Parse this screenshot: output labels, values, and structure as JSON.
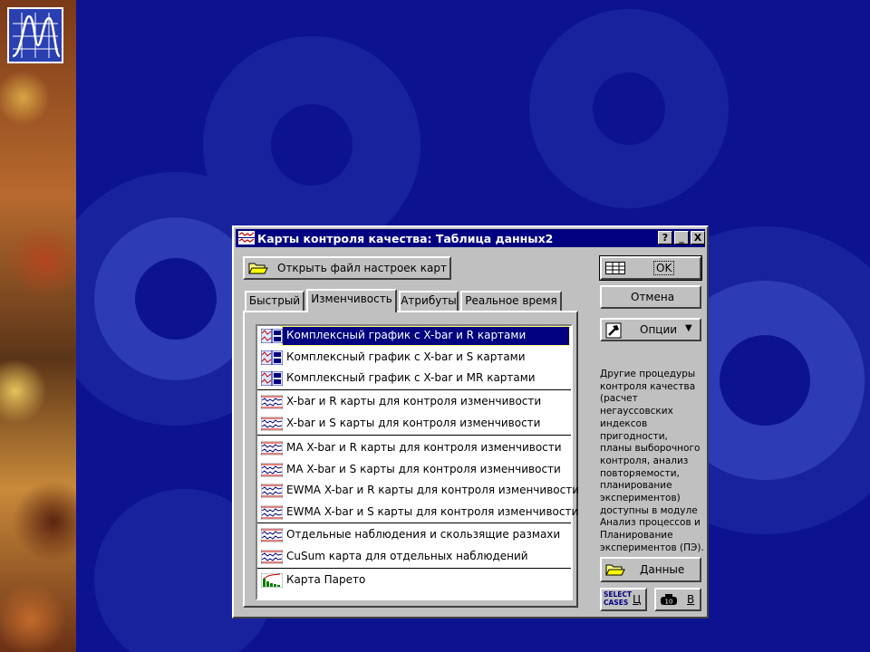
{
  "dialog": {
    "title": "Карты контроля качества: Таблица данных2",
    "title_buttons": [
      "?",
      "_",
      "X"
    ]
  },
  "buttons": {
    "open_settings": "Открыть файл настроек карт",
    "ok": "OK",
    "cancel": "Отмена",
    "options": "Опции",
    "data": "Данные",
    "select_cases_label": "SELECT\nCASES",
    "select_cases_key": "Ц",
    "weights_key": "В"
  },
  "tabs": [
    {
      "label": "Быстрый",
      "active": false
    },
    {
      "label": "Изменчивость",
      "active": true
    },
    {
      "label": "Атрибуты",
      "active": false
    },
    {
      "label": "Реальное время",
      "active": false
    }
  ],
  "list_items": [
    {
      "label": "Комплексный график с X-bar и R картами",
      "icon": "composite-chart-icon",
      "selected": true
    },
    {
      "label": "Комплексный график с X-bar и S картами",
      "icon": "composite-chart-icon",
      "selected": false
    },
    {
      "label": "Комплексный график с X-bar и MR картами",
      "icon": "composite-chart-icon",
      "selected": false
    },
    {
      "label": "X-bar и R карты для контроля изменчивости",
      "icon": "control-chart-icon",
      "selected": false
    },
    {
      "label": "X-bar и S карты для контроля изменчивости",
      "icon": "control-chart-icon",
      "selected": false
    },
    {
      "label": "MA X-bar и R карты для контроля изменчивости",
      "icon": "control-chart-icon",
      "selected": false
    },
    {
      "label": "MA X-bar и S карты для контроля изменчивости",
      "icon": "control-chart-icon",
      "selected": false
    },
    {
      "label": "EWMA X-bar и R карты для контроля изменчивости",
      "icon": "control-chart-icon",
      "selected": false
    },
    {
      "label": "EWMA X-bar и S карты для контроля изменчивости",
      "icon": "control-chart-icon",
      "selected": false
    },
    {
      "label": "Отдельные наблюдения и скользящие размахи",
      "icon": "control-chart-icon",
      "selected": false
    },
    {
      "label": "CuSum карта для отдельных наблюдений",
      "icon": "control-chart-icon",
      "selected": false
    },
    {
      "label": "Карта Парето",
      "icon": "pareto-chart-icon",
      "selected": false
    }
  ],
  "side_note": "Другие процедуры\nконтроля качества\n(расчет негауссовских\nиндексов пригодности,\nпланы выборочного\nконтроля, анализ\nповторяемости,\nпланирование\nэкспериментов)\nдоступны в модуле\nАнализ процессов и\nПланирование\nэкспериментов (ПЭ).",
  "colors": {
    "background": "#0d1390",
    "titlebar": "#000080",
    "face": "#c0c0c0",
    "selection": "#000080"
  }
}
